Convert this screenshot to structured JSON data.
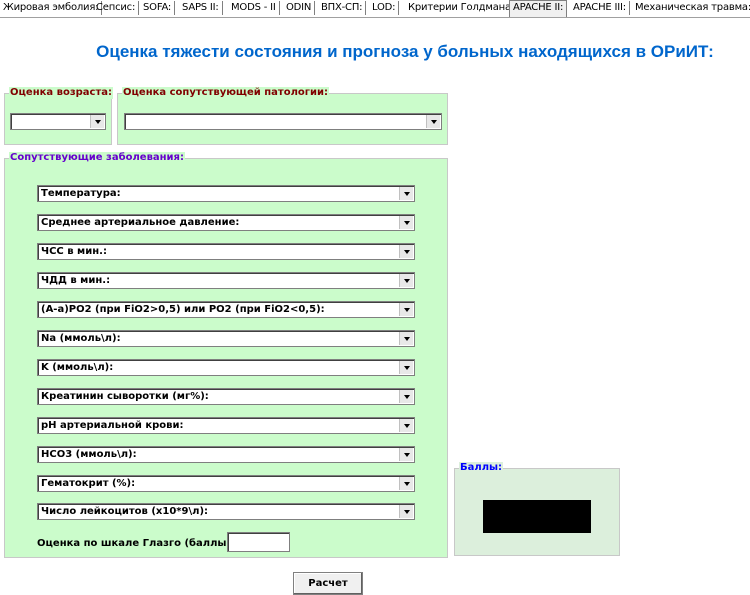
{
  "tabs": [
    {
      "label": "Жировая эмболия:"
    },
    {
      "label": "Сепсис:"
    },
    {
      "label": "SOFA:"
    },
    {
      "label": "SAPS II:"
    },
    {
      "label": "MODS - II"
    },
    {
      "label": "ODIN"
    },
    {
      "label": "ВПХ-СП:"
    },
    {
      "label": "LOD:"
    },
    {
      "label": "Критерии Голдмана:"
    },
    {
      "label": "APACHE II:"
    },
    {
      "label": "APACHE III:"
    },
    {
      "label": "Механическая травма:"
    }
  ],
  "active_tab": "APACHE II:",
  "page_title": "Оценка тяжести состояния и прогноза у больных находящихся в ОРиИТ:",
  "age_group": {
    "legend": "Оценка возраста:",
    "value": ""
  },
  "pathology_group": {
    "legend": "Оценка сопутствующей патологии:",
    "value": ""
  },
  "diseases_group": {
    "legend": "Сопутствующие заболевания:",
    "fields": [
      "Температура:",
      "Среднее артериальное давление:",
      "ЧСС в мин.:",
      "ЧДД в мин.:",
      "(A-a)PO2 (при FiO2>0,5) или PO2 (при FiO2<0,5):",
      "Na (ммоль\\л):",
      "K (ммоль\\л):",
      "Креатинин сыворотки (мг%):",
      "pH артериальной крови:",
      "HCO3 (ммоль\\л):",
      "Гематокрит (%):",
      "Число лейкоцитов (x10*9\\л):"
    ],
    "glasgow_label": "Оценка по шкале Глазго (баллы):",
    "glasgow_value": ""
  },
  "score_group": {
    "legend": "Баллы:",
    "value": ""
  },
  "calc_button": "Расчет",
  "colors": {
    "panel_bg": "#cbfccb",
    "score_bg": "#dcefdc",
    "title": "#0066cc",
    "legend_dark": "#800000",
    "legend_purple": "#6600cc",
    "legend_blue": "#0000ff",
    "score_display": "#000000"
  }
}
